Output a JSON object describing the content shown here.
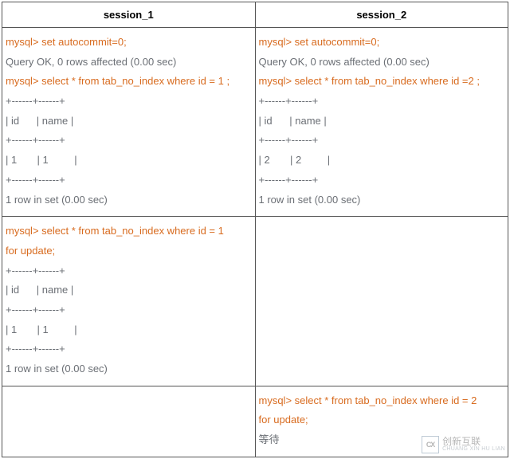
{
  "headers": {
    "col1": "session_1",
    "col2": "session_2"
  },
  "row1": {
    "s1": {
      "cmd1": "mysql> set autocommit=0;",
      "out1": "Query OK, 0 rows affected (0.00 sec)",
      "cmd2": "mysql> select * from tab_no_index where id = 1 ;",
      "sep1": "+------+------+",
      "hdrrow": "| id      | name |",
      "sep2": "+------+------+",
      "datarow": "| 1       | 1         |",
      "sep3": "+------+------+",
      "summary": "1 row in set (0.00 sec)"
    },
    "s2": {
      "cmd1": "mysql> set autocommit=0;",
      "out1": "Query OK, 0 rows affected (0.00 sec)",
      "cmd2": "mysql> select * from tab_no_index where id =2 ;",
      "sep1": "+------+------+",
      "hdrrow": "| id      | name |",
      "sep2": "+------+------+",
      "datarow": "| 2       | 2         |",
      "sep3": "+------+------+",
      "summary": "1 row in set (0.00 sec)"
    }
  },
  "row2": {
    "s1": {
      "cmd1a": "mysql> select * from tab_no_index where id = 1",
      "cmd1b": "for update;",
      "sep1": "+------+------+",
      "hdrrow": "| id      | name |",
      "sep2": "+------+------+",
      "datarow": "| 1       | 1         |",
      "sep3": "+------+------+",
      "summary": "1 row in set (0.00 sec)"
    },
    "s2": ""
  },
  "row3": {
    "s1": "",
    "s2": {
      "cmd1a": "mysql> select * from tab_no_index where id = 2",
      "cmd1b": "for update;",
      "wait": "等待"
    }
  },
  "watermark": {
    "label": "创新互联",
    "sub": "CHUANG XIN HU LIAN"
  }
}
